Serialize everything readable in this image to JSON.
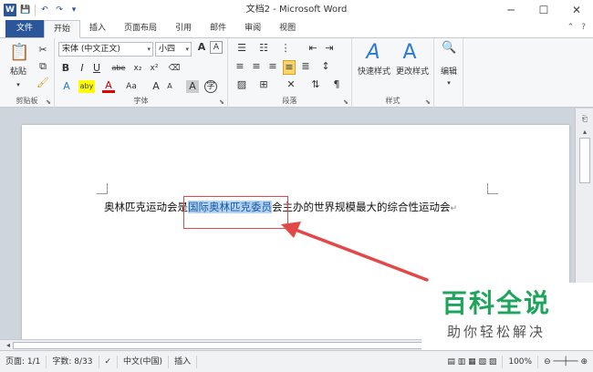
{
  "window": {
    "title": "文档2 - Microsoft Word",
    "quick_access": [
      "W",
      "💾",
      "↶",
      "↷",
      "▾"
    ],
    "controls": [
      "─",
      "☐",
      "✕"
    ]
  },
  "tabs": {
    "file": "文件",
    "items": [
      "开始",
      "插入",
      "页面布局",
      "引用",
      "邮件",
      "审阅",
      "视图"
    ],
    "active": "开始",
    "right_icons": [
      "⌃",
      "?"
    ]
  },
  "ribbon": {
    "clipboard": {
      "label": "剪贴板",
      "paste": "粘贴"
    },
    "font": {
      "label": "字体",
      "font_name": "宋体 (中文正文)",
      "font_size": "小四",
      "grow": "A",
      "shrink": "A",
      "buttons": [
        "B",
        "I",
        "U",
        "abe",
        "x₂",
        "x²",
        "A",
        "aby",
        "A",
        "Aa",
        "A",
        "A",
        "A",
        "字"
      ]
    },
    "paragraph": {
      "label": "段落"
    },
    "styles": {
      "label": "样式",
      "quick_styles": "快速样式",
      "change_styles": "更改样式"
    },
    "editing": {
      "label": "编辑"
    }
  },
  "document": {
    "before": "奥林匹克运动会是",
    "selected": "国际奥林匹克委员",
    "after": "会主办的世界规模最大的综合性运动会",
    "paragraph_mark": "↵"
  },
  "status_bar": {
    "page": "页面: 1/1",
    "words": "字数: 8/33",
    "language": "中文(中国)",
    "mode": "插入",
    "zoom": "100%"
  },
  "watermark": {
    "title": "百科全说",
    "subtitle": "助你轻松解决"
  },
  "colors": {
    "accent": "#2b579a",
    "highlight_box": "#e34848",
    "selection": "#b7d3ef",
    "watermark": "#1fa55b"
  }
}
